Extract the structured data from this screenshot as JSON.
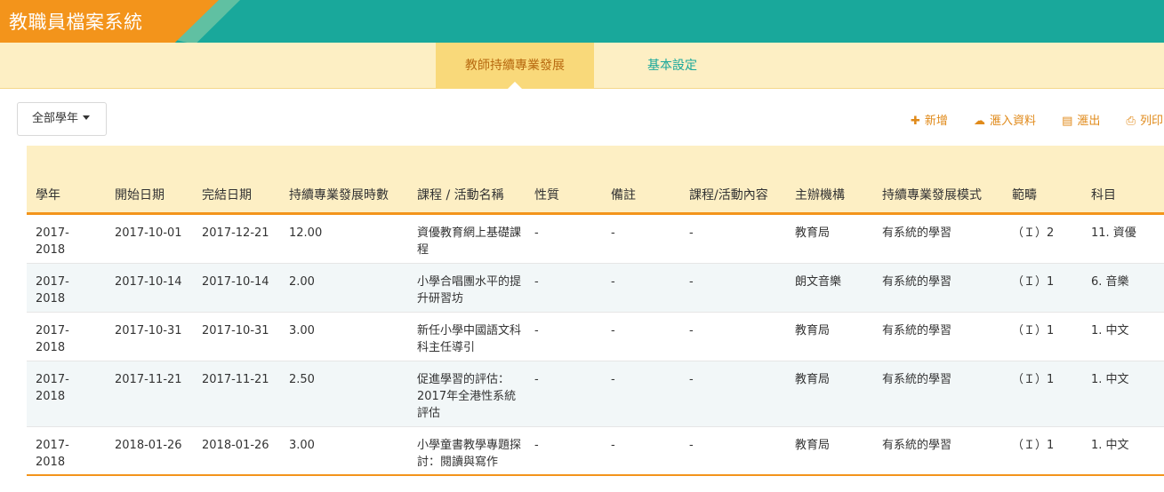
{
  "header": {
    "title": "教職員檔案系統"
  },
  "tabs": [
    {
      "label": "教師持續專業發展",
      "active": true
    },
    {
      "label": "基本設定",
      "active": false
    }
  ],
  "toolbar": {
    "year_filter": "全部學年",
    "actions": [
      {
        "icon": "plus-icon",
        "label": "新增"
      },
      {
        "icon": "cloud-upload-icon",
        "label": "滙入資料"
      },
      {
        "icon": "export-file-icon",
        "label": "滙出"
      },
      {
        "icon": "printer-icon",
        "label": "列印"
      }
    ]
  },
  "colors": {
    "header_teal": "#19a89b",
    "brand_orange": "#f3941b",
    "tab_yellow": "#f9d97a",
    "tabbar_bg": "#fdefc4",
    "action_orange": "#e08a1a"
  },
  "table": {
    "headers": [
      "學年",
      "開始日期",
      "完結日期",
      "持續專業發展時數",
      "課程 / 活動名稱",
      "性質",
      "備註",
      "課程/活動內容",
      "主辦機構",
      "持續專業發展模式",
      "範疇",
      "科目"
    ],
    "rows": [
      [
        "2017-2018",
        "2017-10-01",
        "2017-12-21",
        "12.00",
        "資優教育網上基礎課程",
        "-",
        "-",
        "-",
        "教育局",
        "有系統的學習",
        "（Ｉ）2",
        "11. 資優"
      ],
      [
        "2017-2018",
        "2017-10-14",
        "2017-10-14",
        "2.00",
        "小學合唱團水平的提升研習坊",
        "-",
        "-",
        "-",
        "朗文音樂",
        "有系統的學習",
        "（Ｉ）1",
        "6. 音樂"
      ],
      [
        "2017-2018",
        "2017-10-31",
        "2017-10-31",
        "3.00",
        "新任小學中國語文科科主任導引",
        "-",
        "-",
        "-",
        "教育局",
        "有系統的學習",
        "（Ｉ）1",
        "1. 中文"
      ],
      [
        "2017-2018",
        "2017-11-21",
        "2017-11-21",
        "2.50",
        "促進學習的評估：2017年全港性系統評估",
        "-",
        "-",
        "-",
        "教育局",
        "有系統的學習",
        "（Ｉ）1",
        "1. 中文"
      ],
      [
        "2017-2018",
        "2018-01-26",
        "2018-01-26",
        "3.00",
        "小學童書教學專題探討：閱讀與寫作",
        "-",
        "-",
        "-",
        "教育局",
        "有系統的學習",
        "（Ｉ）1",
        "1. 中文"
      ]
    ]
  }
}
